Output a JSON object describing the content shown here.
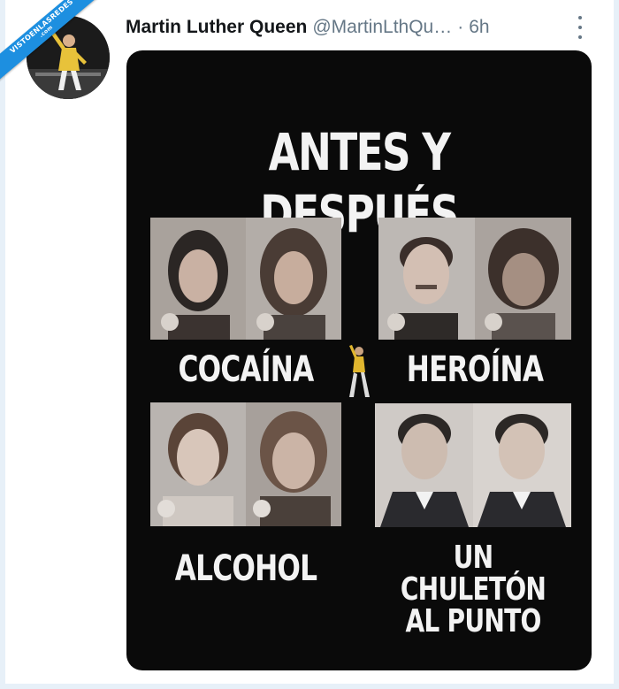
{
  "tweet": {
    "author_name": "Martin Luther Queen",
    "handle": "@MartinLthQu…",
    "separator": "·",
    "time": "6h"
  },
  "watermark": {
    "text": "VISTOENLASREDES",
    "sub": ".com"
  },
  "meme": {
    "title": "ANTES Y DESPUÉS",
    "panels": [
      {
        "label": "COCAÍNA"
      },
      {
        "label": "HEROÍNA"
      },
      {
        "label": "ALCOHOL"
      },
      {
        "label_line1": "UN CHULETÓN",
        "label_line2": "AL PUNTO"
      }
    ]
  },
  "colors": {
    "name": "#14171a",
    "secondary": "#657786",
    "media_bg": "#0a0a0a",
    "watermark": "#1d8fe0"
  },
  "icons": {
    "more": "more-vertical-icon",
    "avatar": "avatar-performer"
  }
}
